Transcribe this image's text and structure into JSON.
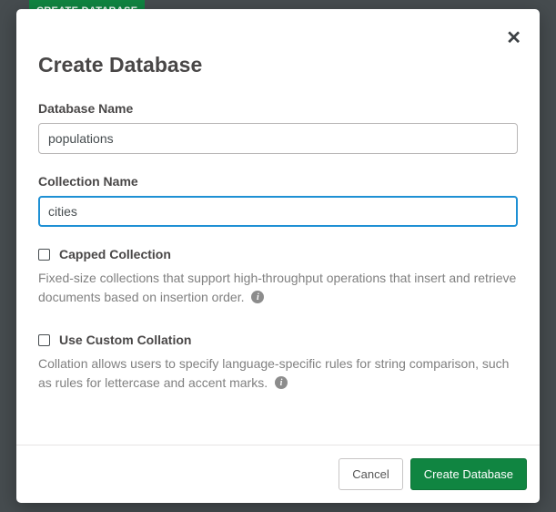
{
  "background": {
    "button_label": "CREATE DATABASE"
  },
  "modal": {
    "title": "Create Database",
    "close_symbol": "✕",
    "fields": {
      "database_name": {
        "label": "Database Name",
        "value": "populations"
      },
      "collection_name": {
        "label": "Collection Name",
        "value": "cities"
      }
    },
    "options": {
      "capped": {
        "label": "Capped Collection",
        "description": "Fixed-size collections that support high-throughput operations that insert and retrieve documents based on insertion order.",
        "info_glyph": "i"
      },
      "collation": {
        "label": "Use Custom Collation",
        "description": "Collation allows users to specify language-specific rules for string comparison, such as rules for lettercase and accent marks.",
        "info_glyph": "i"
      }
    },
    "footer": {
      "cancel": "Cancel",
      "submit": "Create Database"
    }
  }
}
